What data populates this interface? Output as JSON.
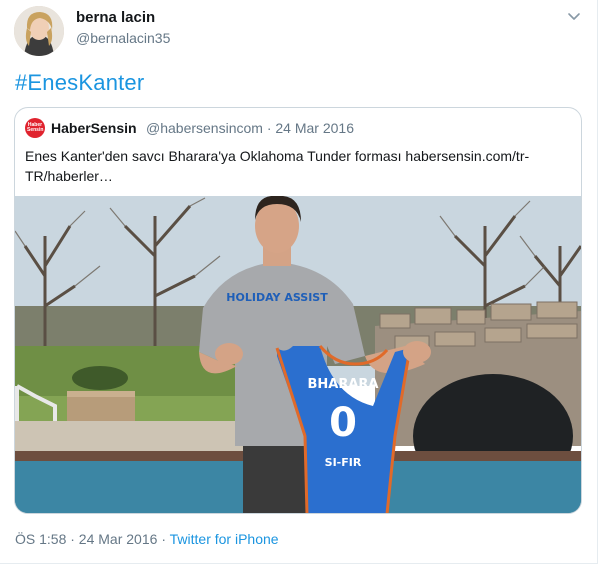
{
  "author": {
    "name": "berna lacin",
    "handle": "@bernalacin35"
  },
  "hashtag": "#EnesKanter",
  "quoted": {
    "logo_text": "Haber Sensin",
    "name": "HaberSensin",
    "handle": "@habersensincom",
    "separator": "·",
    "date": "24 Mar 2016",
    "text": "Enes Kanter'den savcı Bharara'ya Oklahoma Tunder forması habersensin.com/tr-TR/haberler…",
    "photo": {
      "shirt_text": "HOLIDAY ASSIST",
      "jersey_name": "BHARARA",
      "jersey_number": "0",
      "jersey_bottom": "SI-FIR"
    }
  },
  "footer": {
    "timestamp": "ÖS 1:58 · 24 Mar 2016",
    "separator": "·",
    "source": "Twitter for iPhone"
  },
  "colors": {
    "link": "#1b95e0",
    "secondary_text": "#657786",
    "jersey_blue": "#2b6fcf"
  }
}
